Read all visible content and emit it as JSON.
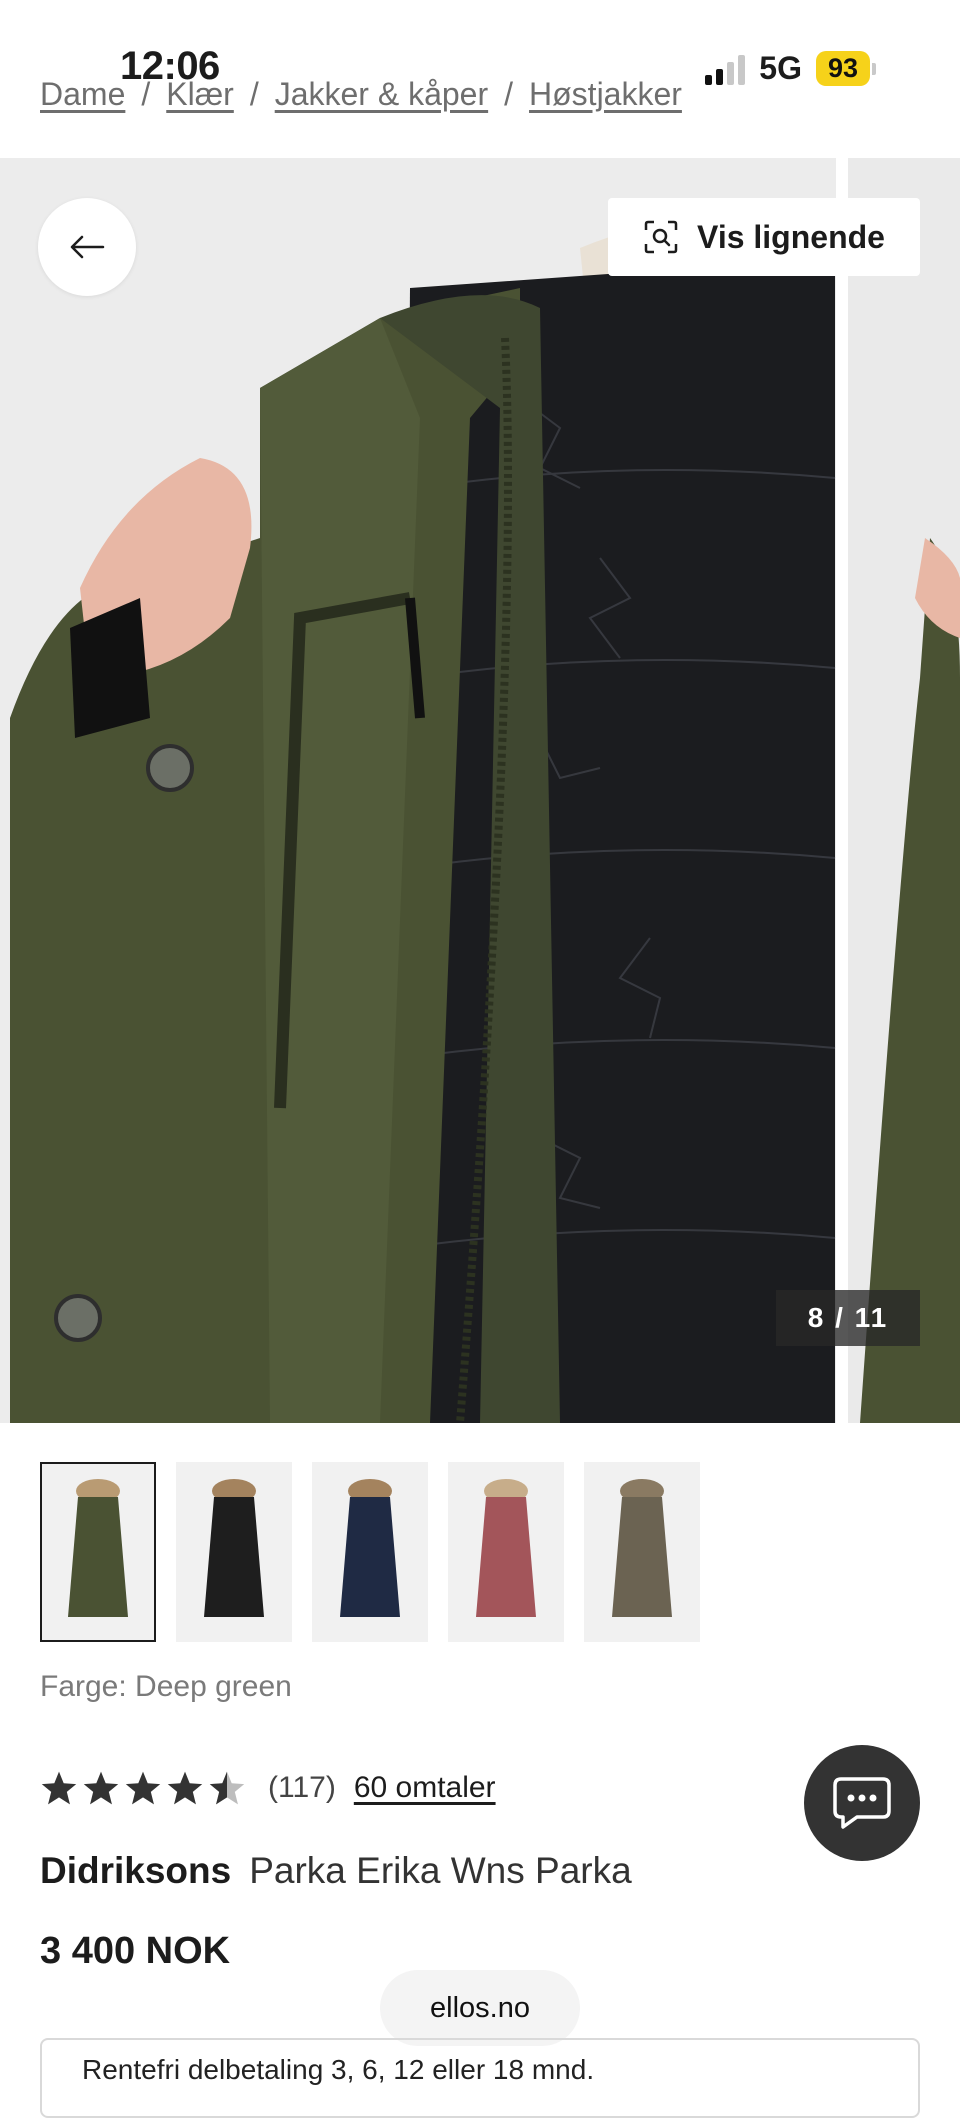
{
  "status_bar": {
    "time": "12:06",
    "network": "5G",
    "battery": "93"
  },
  "breadcrumb": [
    "Dame",
    "Klær",
    "Jakker & kåper",
    "Høstjakker"
  ],
  "gallery": {
    "similar_label": "Vis lignende",
    "counter": "8 / 11",
    "icons": {
      "back": "arrow-left-icon",
      "similar": "visual-search-icon"
    }
  },
  "colors": {
    "label": "Farge: Deep green",
    "swatches": [
      {
        "name": "Deep green",
        "hex": "#4a5233",
        "selected": true
      },
      {
        "name": "Black",
        "hex": "#1e1e1e",
        "selected": false
      },
      {
        "name": "Navy",
        "hex": "#1f2a44",
        "selected": false
      },
      {
        "name": "Rose",
        "hex": "#a3555a",
        "selected": false
      },
      {
        "name": "Brown",
        "hex": "#6b6352",
        "selected": false
      }
    ]
  },
  "rating": {
    "stars": 4.5,
    "count": "(117)",
    "reviews_link": "60 omtaler"
  },
  "product": {
    "brand": "Didriksons",
    "name": "Parka Erika Wns Parka",
    "price": "3 400 NOK"
  },
  "browser": {
    "domain": "ellos.no"
  },
  "finance": {
    "text": "Rentefri delbetaling 3, 6, 12 eller 18 mnd."
  },
  "theme": {
    "accent": "#f6d21a",
    "jacket": "#4a5233",
    "text": "#1c1c1c"
  }
}
